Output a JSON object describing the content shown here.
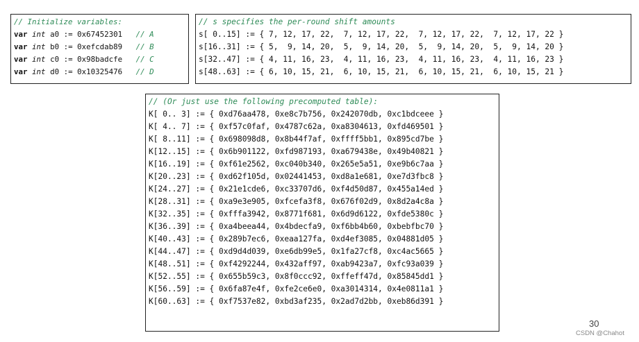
{
  "vars": {
    "comment": "// Initialize variables:",
    "rows": [
      {
        "kw": "var",
        "type": "int",
        "assign": "a0 := 0x67452301",
        "comment": "// A"
      },
      {
        "kw": "var",
        "type": "int",
        "assign": "b0 := 0xefcdab89",
        "comment": "// B"
      },
      {
        "kw": "var",
        "type": "int",
        "assign": "c0 := 0x98badcfe",
        "comment": "// C"
      },
      {
        "kw": "var",
        "type": "int",
        "assign": "d0 := 0x10325476",
        "comment": "// D"
      }
    ]
  },
  "shift": {
    "comment": "// s specifies the per-round shift amounts",
    "rows": [
      "s[ 0..15] := { 7, 12, 17, 22,  7, 12, 17, 22,  7, 12, 17, 22,  7, 12, 17, 22 }",
      "s[16..31] := { 5,  9, 14, 20,  5,  9, 14, 20,  5,  9, 14, 20,  5,  9, 14, 20 }",
      "s[32..47] := { 4, 11, 16, 23,  4, 11, 16, 23,  4, 11, 16, 23,  4, 11, 16, 23 }",
      "s[48..63] := { 6, 10, 15, 21,  6, 10, 15, 21,  6, 10, 15, 21,  6, 10, 15, 21 }"
    ]
  },
  "table": {
    "comment": "// (Or just use the following precomputed table):",
    "rows": [
      "K[ 0.. 3] := { 0xd76aa478, 0xe8c7b756, 0x242070db, 0xc1bdceee }",
      "K[ 4.. 7] := { 0xf57c0faf, 0x4787c62a, 0xa8304613, 0xfd469501 }",
      "K[ 8..11] := { 0x698098d8, 0x8b44f7af, 0xffff5bb1, 0x895cd7be }",
      "K[12..15] := { 0x6b901122, 0xfd987193, 0xa679438e, 0x49b40821 }",
      "K[16..19] := { 0xf61e2562, 0xc040b340, 0x265e5a51, 0xe9b6c7aa }",
      "K[20..23] := { 0xd62f105d, 0x02441453, 0xd8a1e681, 0xe7d3fbc8 }",
      "K[24..27] := { 0x21e1cde6, 0xc33707d6, 0xf4d50d87, 0x455a14ed }",
      "K[28..31] := { 0xa9e3e905, 0xfcefa3f8, 0x676f02d9, 0x8d2a4c8a }",
      "K[32..35] := { 0xfffa3942, 0x8771f681, 0x6d9d6122, 0xfde5380c }",
      "K[36..39] := { 0xa4beea44, 0x4bdecfa9, 0xf6bb4b60, 0xbebfbc70 }",
      "K[40..43] := { 0x289b7ec6, 0xeaa127fa, 0xd4ef3085, 0x04881d05 }",
      "K[44..47] := { 0xd9d4d039, 0xe6db99e5, 0x1fa27cf8, 0xc4ac5665 }",
      "K[48..51] := { 0xf4292244, 0x432aff97, 0xab9423a7, 0xfc93a039 }",
      "K[52..55] := { 0x655b59c3, 0x8f0ccc92, 0xffeff47d, 0x85845dd1 }",
      "K[56..59] := { 0x6fa87e4f, 0xfe2ce6e0, 0xa3014314, 0x4e0811a1 }",
      "K[60..63] := { 0xf7537e82, 0xbd3af235, 0x2ad7d2bb, 0xeb86d391 }"
    ]
  },
  "page_number": "30",
  "credit": "CSDN @Chahot",
  "colors": {
    "comment": "#2e8b57",
    "border": "#222222"
  }
}
